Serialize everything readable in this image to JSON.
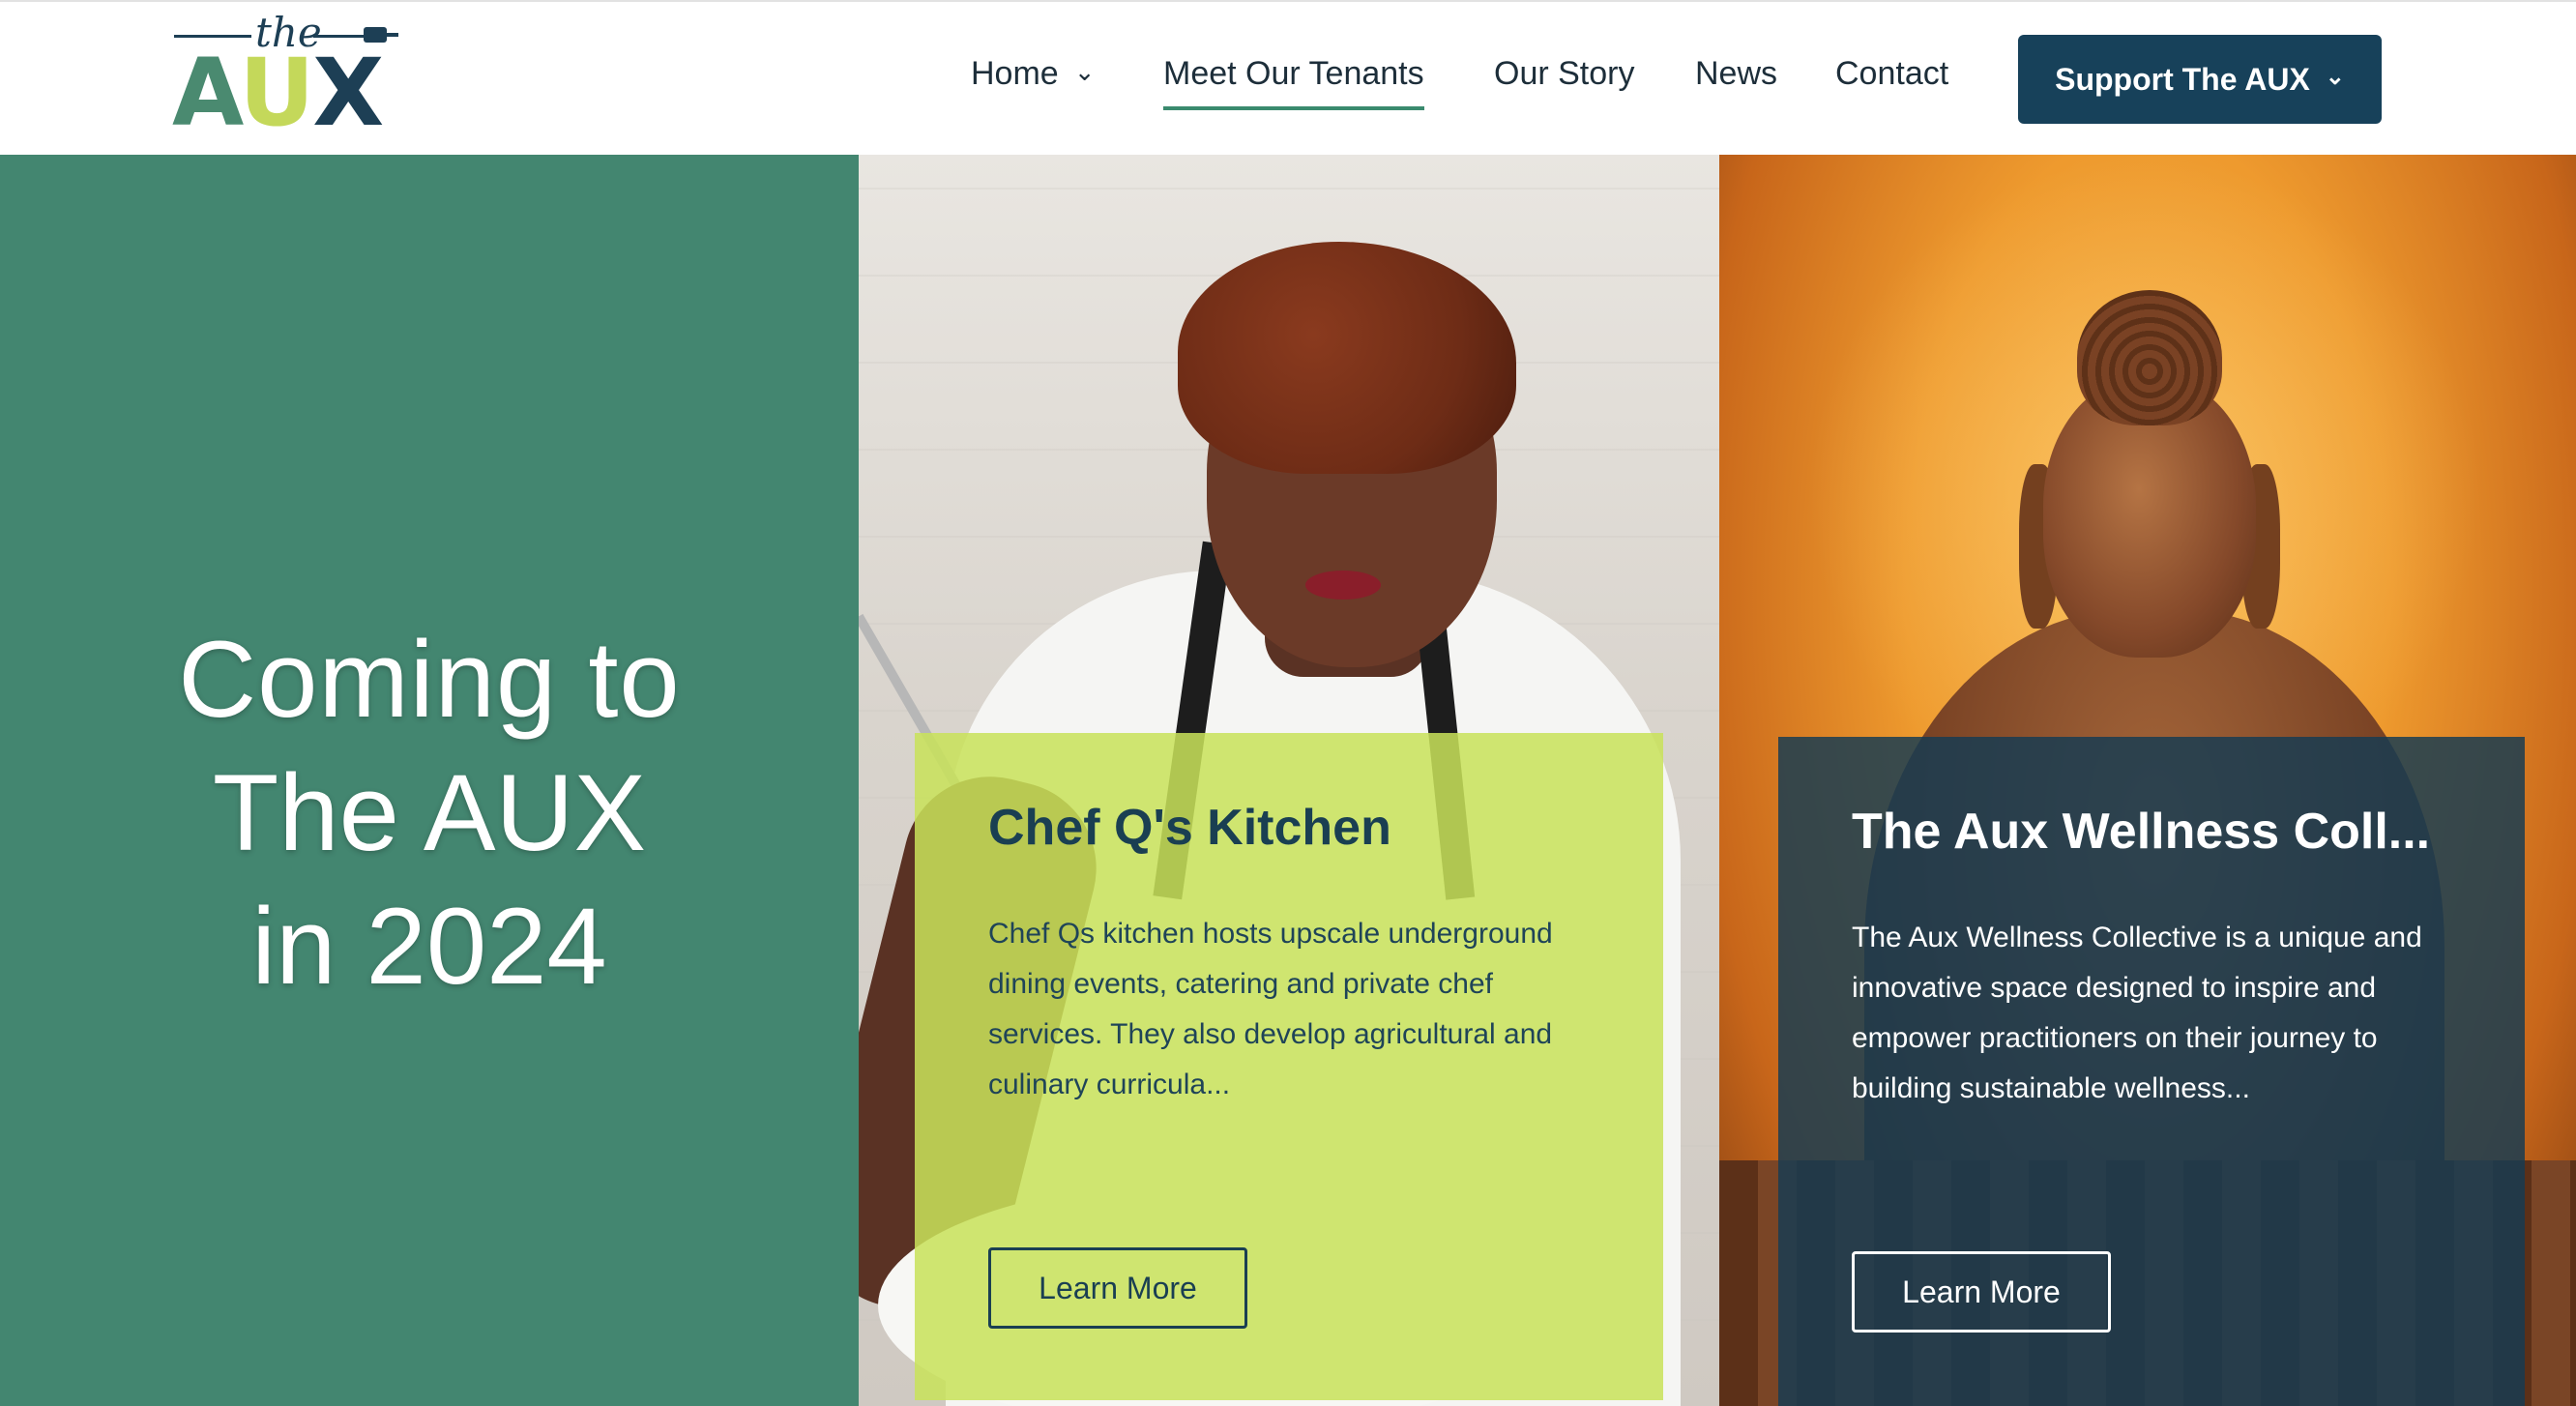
{
  "logo": {
    "the": "the",
    "letters": [
      "A",
      "U",
      "X"
    ]
  },
  "nav": {
    "items": [
      {
        "label": "Home",
        "has_dropdown": true
      },
      {
        "label": "Meet Our Tenants",
        "active": true
      },
      {
        "label": "Our Story"
      },
      {
        "label": "News"
      },
      {
        "label": "Contact"
      }
    ],
    "support": {
      "label": "Support The AUX",
      "has_dropdown": true
    },
    "chevron": "⌄"
  },
  "hero": {
    "line1": "Coming to",
    "line2": "The AUX",
    "line3": "in 2024"
  },
  "tenants": [
    {
      "title": "Chef Q's Kitchen",
      "description": "Chef Qs kitchen hosts upscale underground dining events, catering and private chef services. They also develop agricultural and culinary curricula...",
      "button": "Learn More",
      "image": "chef-cooking-photo"
    },
    {
      "title": "The Aux Wellness Coll...",
      "description": "The Aux Wellness Collective is a unique and innovative space designed to inspire and empower practitioners on their journey to building sustainable wellness...",
      "button": "Learn More",
      "image": "buddha-statue-photo"
    }
  ],
  "colors": {
    "brand_green": "#438670",
    "brand_lime": "#c4d85a",
    "brand_navy": "#17415a",
    "active_underline": "#3a8a6e"
  }
}
